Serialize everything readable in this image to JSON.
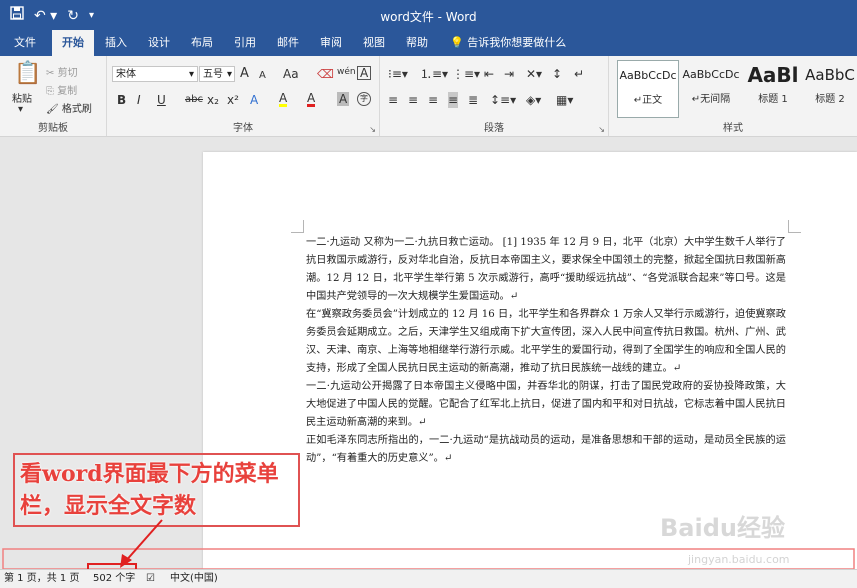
{
  "window": {
    "title": "word文件 - Word"
  },
  "qat": {
    "save_icon": "save-icon",
    "undo_icon": "undo-icon",
    "redo_icon": "redo-icon",
    "customize_icon": "customize-icon"
  },
  "tabs": [
    "文件",
    "开始",
    "插入",
    "设计",
    "布局",
    "引用",
    "邮件",
    "审阅",
    "视图",
    "帮助"
  ],
  "tell_me": "告诉我你想要做什么",
  "ribbon": {
    "clipboard": {
      "paste": "粘贴",
      "cut": "剪切",
      "copy": "复制",
      "format_painter": "格式刷",
      "label": "剪贴板"
    },
    "font": {
      "name": "宋体",
      "size": "五号",
      "label": "字体",
      "aa": "Aa",
      "bold": "B",
      "italic": "I",
      "underline": "U",
      "strike": "abc",
      "sub": "x₂",
      "sup": "x²",
      "grow": "A",
      "shrink": "A",
      "wen": "wén",
      "border_a": "A",
      "color_a": "A",
      "highlight_a": "A",
      "shade_a": "A",
      "circle": "字"
    },
    "paragraph": {
      "label": "段落"
    },
    "styles": {
      "label": "样式",
      "items": [
        {
          "sample": "AaBbCcDc",
          "name": "↵正文"
        },
        {
          "sample": "AaBbCcDc",
          "name": "↵无间隔"
        },
        {
          "sample": "AaBl",
          "name": "标题 1"
        },
        {
          "sample": "AaBbC",
          "name": "标题 2"
        }
      ]
    }
  },
  "document": {
    "paragraphs": [
      "一二·九运动 又称为一二·九抗日救亡运动。 [1] 1935 年 12 月 9 日，北平（北京）大中学生数千人举行了抗日救国示威游行，反对华北自治，反抗日本帝国主义，要求保全中国领土的完整，掀起全国抗日救国新高潮。12 月 12 日，北平学生举行第 5 次示威游行，高呼“援助绥远抗战”、“各党派联合起来”等口号。这是中国共产党领导的一次大规模学生爱国运动。↵",
      "在“冀察政务委员会”计划成立的 12 月 16 日，北平学生和各界群众 1 万余人又举行示威游行，迫使冀察政务委员会延期成立。之后，天津学生又组成南下扩大宣传团，深入人民中间宣传抗日救国。杭州、广州、武汉、天津、南京、上海等地相继举行游行示威。北平学生的爱国行动，得到了全国学生的响应和全国人民的支持，形成了全国人民抗日民主运动的新高潮，推动了抗日民族统一战线的建立。↵",
      "一二·九运动公开揭露了日本帝国主义侵略中国，并吞华北的阴谋，打击了国民党政府的妥协投降政策，大大地促进了中国人民的觉醒。它配合了红军北上抗日，促进了国内和平和对日抗战，它标志着中国人民抗日民主运动新高潮的来到。↵",
      "正如毛泽东同志所指出的，一二·九运动“是抗战动员的运动，是准备思想和干部的运动，是动员全民族的运动”，“有着重大的历史意义”。↵"
    ]
  },
  "annotation": {
    "text": "看word界面最下方的菜单栏，显示全文字数",
    "color": "#e8413c"
  },
  "statusbar": {
    "page": "第 1 页，共 1 页",
    "word_count": "502 个字",
    "proof_icon": "proofing-icon",
    "language": "中文(中国)"
  },
  "watermark": {
    "text": "Baidu经验",
    "url": "jingyan.baidu.com"
  },
  "colors": {
    "accent": "#2b579a",
    "annotation": "#e05252"
  }
}
